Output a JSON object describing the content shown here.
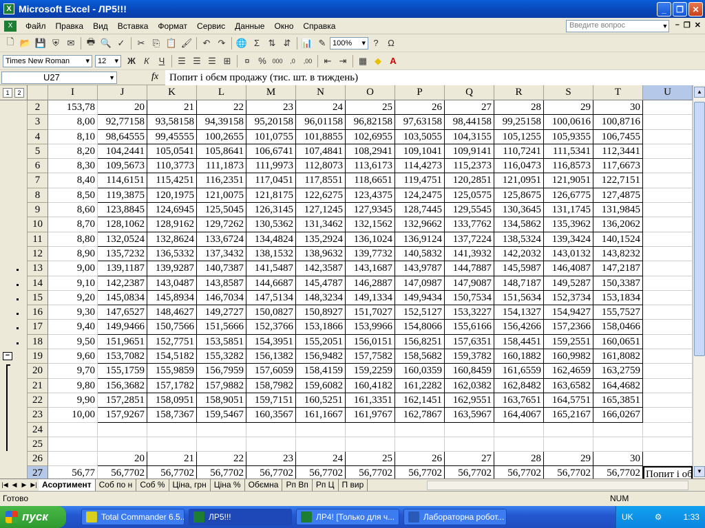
{
  "window": {
    "title": "Microsoft Excel - ЛР5!!!"
  },
  "menu": {
    "items": [
      "Файл",
      "Правка",
      "Вид",
      "Вставка",
      "Формат",
      "Сервис",
      "Данные",
      "Окно",
      "Справка"
    ],
    "ask_placeholder": "Введите вопрос"
  },
  "toolbar": {
    "zoom": "100%",
    "font": "Times New Roman",
    "font_size": "12"
  },
  "formula_bar": {
    "cell_ref": "U27",
    "fx": "fx",
    "formula": "Попит і обєм продажу (тис. шт. в тиждень)"
  },
  "outline": {
    "levels": [
      "1",
      "2"
    ],
    "collapse": "−"
  },
  "columns": [
    "I",
    "J",
    "K",
    "L",
    "M",
    "N",
    "O",
    "P",
    "Q",
    "R",
    "S",
    "T",
    "U"
  ],
  "rows": [
    {
      "n": "2",
      "v": [
        "153,78",
        "20",
        "21",
        "22",
        "23",
        "24",
        "25",
        "26",
        "27",
        "28",
        "29",
        "30",
        ""
      ]
    },
    {
      "n": "3",
      "v": [
        "8,00",
        "92,77158",
        "93,58158",
        "94,39158",
        "95,20158",
        "96,01158",
        "96,82158",
        "97,63158",
        "98,44158",
        "99,25158",
        "100,0616",
        "100,8716",
        ""
      ]
    },
    {
      "n": "4",
      "v": [
        "8,10",
        "98,64555",
        "99,45555",
        "100,2655",
        "101,0755",
        "101,8855",
        "102,6955",
        "103,5055",
        "104,3155",
        "105,1255",
        "105,9355",
        "106,7455",
        ""
      ]
    },
    {
      "n": "5",
      "v": [
        "8,20",
        "104,2441",
        "105,0541",
        "105,8641",
        "106,6741",
        "107,4841",
        "108,2941",
        "109,1041",
        "109,9141",
        "110,7241",
        "111,5341",
        "112,3441",
        ""
      ]
    },
    {
      "n": "6",
      "v": [
        "8,30",
        "109,5673",
        "110,3773",
        "111,1873",
        "111,9973",
        "112,8073",
        "113,6173",
        "114,4273",
        "115,2373",
        "116,0473",
        "116,8573",
        "117,6673",
        ""
      ]
    },
    {
      "n": "7",
      "v": [
        "8,40",
        "114,6151",
        "115,4251",
        "116,2351",
        "117,0451",
        "117,8551",
        "118,6651",
        "119,4751",
        "120,2851",
        "121,0951",
        "121,9051",
        "122,7151",
        ""
      ]
    },
    {
      "n": "8",
      "v": [
        "8,50",
        "119,3875",
        "120,1975",
        "121,0075",
        "121,8175",
        "122,6275",
        "123,4375",
        "124,2475",
        "125,0575",
        "125,8675",
        "126,6775",
        "127,4875",
        ""
      ]
    },
    {
      "n": "9",
      "v": [
        "8,60",
        "123,8845",
        "124,6945",
        "125,5045",
        "126,3145",
        "127,1245",
        "127,9345",
        "128,7445",
        "129,5545",
        "130,3645",
        "131,1745",
        "131,9845",
        ""
      ]
    },
    {
      "n": "10",
      "v": [
        "8,70",
        "128,1062",
        "128,9162",
        "129,7262",
        "130,5362",
        "131,3462",
        "132,1562",
        "132,9662",
        "133,7762",
        "134,5862",
        "135,3962",
        "136,2062",
        ""
      ]
    },
    {
      "n": "11",
      "v": [
        "8,80",
        "132,0524",
        "132,8624",
        "133,6724",
        "134,4824",
        "135,2924",
        "136,1024",
        "136,9124",
        "137,7224",
        "138,5324",
        "139,3424",
        "140,1524",
        ""
      ]
    },
    {
      "n": "12",
      "v": [
        "8,90",
        "135,7232",
        "136,5332",
        "137,3432",
        "138,1532",
        "138,9632",
        "139,7732",
        "140,5832",
        "141,3932",
        "142,2032",
        "143,0132",
        "143,8232",
        ""
      ]
    },
    {
      "n": "13",
      "v": [
        "9,00",
        "139,1187",
        "139,9287",
        "140,7387",
        "141,5487",
        "142,3587",
        "143,1687",
        "143,9787",
        "144,7887",
        "145,5987",
        "146,4087",
        "147,2187",
        ""
      ]
    },
    {
      "n": "14",
      "v": [
        "9,10",
        "142,2387",
        "143,0487",
        "143,8587",
        "144,6687",
        "145,4787",
        "146,2887",
        "147,0987",
        "147,9087",
        "148,7187",
        "149,5287",
        "150,3387",
        ""
      ]
    },
    {
      "n": "15",
      "v": [
        "9,20",
        "145,0834",
        "145,8934",
        "146,7034",
        "147,5134",
        "148,3234",
        "149,1334",
        "149,9434",
        "150,7534",
        "151,5634",
        "152,3734",
        "153,1834",
        ""
      ]
    },
    {
      "n": "16",
      "v": [
        "9,30",
        "147,6527",
        "148,4627",
        "149,2727",
        "150,0827",
        "150,8927",
        "151,7027",
        "152,5127",
        "153,3227",
        "154,1327",
        "154,9427",
        "155,7527",
        ""
      ]
    },
    {
      "n": "17",
      "v": [
        "9,40",
        "149,9466",
        "150,7566",
        "151,5666",
        "152,3766",
        "153,1866",
        "153,9966",
        "154,8066",
        "155,6166",
        "156,4266",
        "157,2366",
        "158,0466",
        ""
      ]
    },
    {
      "n": "18",
      "v": [
        "9,50",
        "151,9651",
        "152,7751",
        "153,5851",
        "154,3951",
        "155,2051",
        "156,0151",
        "156,8251",
        "157,6351",
        "158,4451",
        "159,2551",
        "160,0651",
        ""
      ]
    },
    {
      "n": "19",
      "v": [
        "9,60",
        "153,7082",
        "154,5182",
        "155,3282",
        "156,1382",
        "156,9482",
        "157,7582",
        "158,5682",
        "159,3782",
        "160,1882",
        "160,9982",
        "161,8082",
        ""
      ]
    },
    {
      "n": "20",
      "v": [
        "9,70",
        "155,1759",
        "155,9859",
        "156,7959",
        "157,6059",
        "158,4159",
        "159,2259",
        "160,0359",
        "160,8459",
        "161,6559",
        "162,4659",
        "163,2759",
        ""
      ]
    },
    {
      "n": "21",
      "v": [
        "9,80",
        "156,3682",
        "157,1782",
        "157,9882",
        "158,7982",
        "159,6082",
        "160,4182",
        "161,2282",
        "162,0382",
        "162,8482",
        "163,6582",
        "164,4682",
        ""
      ]
    },
    {
      "n": "22",
      "v": [
        "9,90",
        "157,2851",
        "158,0951",
        "158,9051",
        "159,7151",
        "160,5251",
        "161,3351",
        "162,1451",
        "162,9551",
        "163,7651",
        "164,5751",
        "165,3851",
        ""
      ]
    },
    {
      "n": "23",
      "v": [
        "10,00",
        "157,9267",
        "158,7367",
        "159,5467",
        "160,3567",
        "161,1667",
        "161,9767",
        "162,7867",
        "163,5967",
        "164,4067",
        "165,2167",
        "166,0267",
        ""
      ]
    },
    {
      "n": "24",
      "v": [
        "",
        "",
        "",
        "",
        "",
        "",
        "",
        "",
        "",
        "",
        "",
        "",
        ""
      ]
    },
    {
      "n": "25",
      "v": [
        "",
        "",
        "",
        "",
        "",
        "",
        "",
        "",
        "",
        "",
        "",
        "",
        ""
      ]
    },
    {
      "n": "26",
      "v": [
        "",
        "20",
        "21",
        "22",
        "23",
        "24",
        "25",
        "26",
        "27",
        "28",
        "29",
        "30",
        ""
      ]
    },
    {
      "n": "27",
      "v": [
        "56,77",
        "56,7702",
        "56,7702",
        "56,7702",
        "56,7702",
        "56,7702",
        "56,7702",
        "56,7702",
        "56,7702",
        "56,7702",
        "56,7702",
        "56,7702",
        "Попит і об"
      ]
    }
  ],
  "sheets": [
    "Асортимент",
    "Соб по н",
    "Соб %",
    "Ціна, грн",
    "Ціна %",
    "Обємна",
    "Рп Вп",
    "Рп Ц",
    "П вир"
  ],
  "status": {
    "text": "Готово",
    "num": "NUM"
  },
  "taskbar": {
    "start": "пуск",
    "tasks": [
      "Total Commander 6.5...",
      "ЛР5!!!",
      "ЛР4!  [Только для ч...",
      "Лабораторна робот..."
    ],
    "lang": "UK",
    "clock": "1:33"
  },
  "colors": {
    "title_blue": "#0846b8",
    "selected_header": "#b6c8e8",
    "start_green": "#2e9a2e"
  }
}
